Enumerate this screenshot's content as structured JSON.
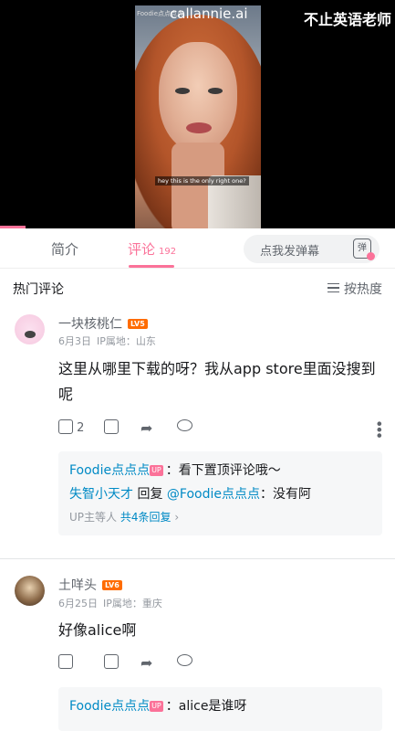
{
  "video": {
    "watermark": "Foodie点点点点",
    "brand": "callannie.ai",
    "subtitle": "hey this is the only right one?",
    "channel_name": "不止英语老师"
  },
  "tabs": {
    "intro_label": "简介",
    "comments_label": "评论",
    "comments_count": "192",
    "danmaku_placeholder": "点我发弹幕",
    "danmaku_icon_char": "弹"
  },
  "hot": {
    "title": "热门评论",
    "sort_label": "按热度"
  },
  "comments": [
    {
      "username": "一块核桃仁",
      "level": "LV5",
      "date": "6月3日",
      "location": "IP属地：山东",
      "text": "这里从哪里下载的呀？我从app store里面没搜到呢",
      "likes": "2",
      "replies": [
        {
          "author": "Foodie点点点",
          "badge": "UP",
          "sep": "：",
          "content": "看下置顶评论哦～"
        },
        {
          "author": "失智小天才",
          "mid": "回复",
          "target": "@Foodie点点点",
          "sep": "：",
          "content": "没有阿"
        }
      ],
      "more_prefix": "UP主等人",
      "more_link": "共4条回复",
      "more_arrow": "›"
    },
    {
      "username": "土咩头",
      "level": "LV6",
      "date": "6月25日",
      "location": "IP属地：重庆",
      "text": "好像alice啊",
      "likes": "",
      "replies": [
        {
          "author": "Foodie点点点",
          "badge": "UP",
          "sep": "：",
          "content": "alice是谁呀"
        }
      ]
    }
  ],
  "colors": {
    "accent": "#fb7299",
    "link": "#008ac5",
    "level": "#ff6c00"
  }
}
